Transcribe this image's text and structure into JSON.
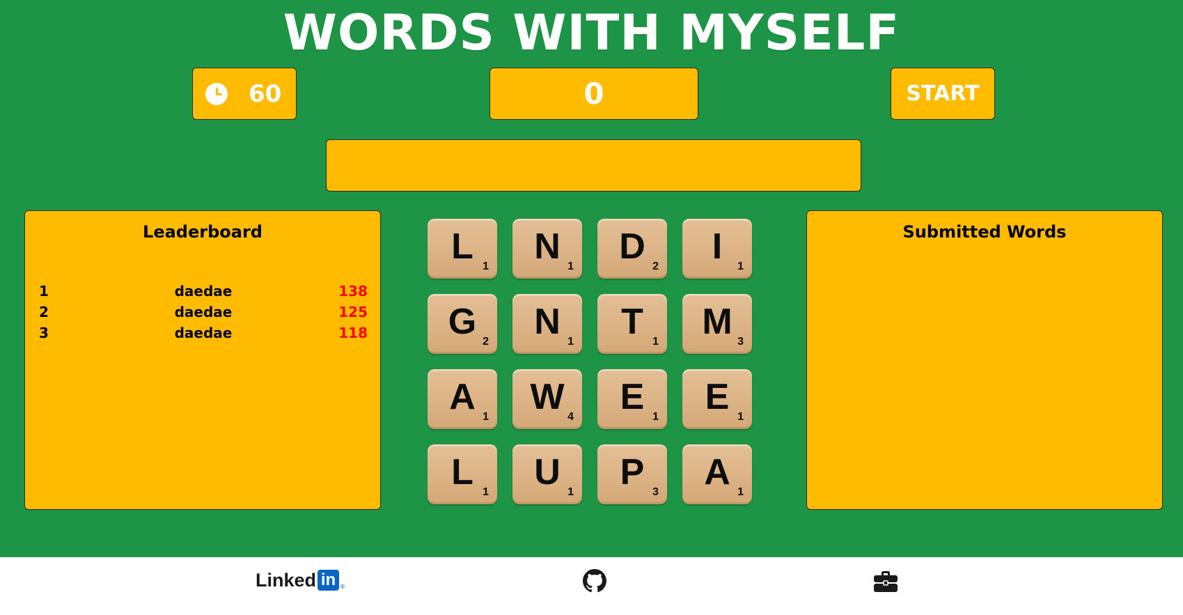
{
  "header": {
    "title": "WORDS WITH MYSELF"
  },
  "controls": {
    "timer_icon": "clock-icon",
    "timer_value": "60",
    "score": "0",
    "start_label": "START",
    "word_input_value": ""
  },
  "leaderboard": {
    "title": "Leaderboard",
    "rows": [
      {
        "rank": "1",
        "name": "daedae",
        "score": "138"
      },
      {
        "rank": "2",
        "name": "daedae",
        "score": "125"
      },
      {
        "rank": "3",
        "name": "daedae",
        "score": "118"
      }
    ]
  },
  "submitted": {
    "title": "Submitted Words",
    "words": []
  },
  "board": {
    "tiles": [
      {
        "letter": "L",
        "points": "1"
      },
      {
        "letter": "N",
        "points": "1"
      },
      {
        "letter": "D",
        "points": "2"
      },
      {
        "letter": "I",
        "points": "1"
      },
      {
        "letter": "G",
        "points": "2"
      },
      {
        "letter": "N",
        "points": "1"
      },
      {
        "letter": "T",
        "points": "1"
      },
      {
        "letter": "M",
        "points": "3"
      },
      {
        "letter": "A",
        "points": "1"
      },
      {
        "letter": "W",
        "points": "4"
      },
      {
        "letter": "E",
        "points": "1"
      },
      {
        "letter": "E",
        "points": "1"
      },
      {
        "letter": "L",
        "points": "1"
      },
      {
        "letter": "U",
        "points": "1"
      },
      {
        "letter": "P",
        "points": "3"
      },
      {
        "letter": "A",
        "points": "1"
      }
    ]
  },
  "footer": {
    "linkedin_text": "Linked",
    "linkedin_badge": "in",
    "linkedin_reg": "®",
    "github_icon": "github-icon",
    "portfolio_icon": "briefcase-icon"
  },
  "colors": {
    "background": "#1e9446",
    "panel": "#ffbb00",
    "score_highlight": "#ff0000",
    "tile": "#dcb386"
  }
}
